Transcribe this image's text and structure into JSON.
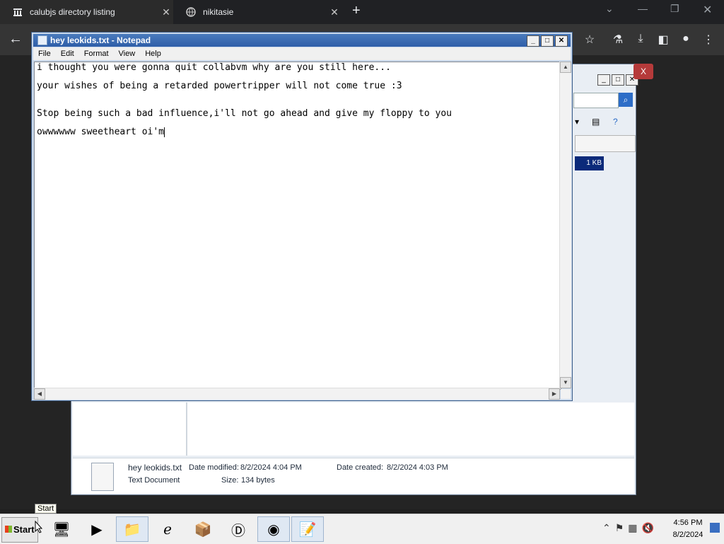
{
  "browser": {
    "tabs": [
      {
        "label": "calubjs directory listing",
        "icon": "bank-icon",
        "active": true
      },
      {
        "label": "nikitasie",
        "icon": "globe-icon",
        "active": false
      }
    ],
    "new_tab_icon": "+"
  },
  "explorer": {
    "selected_file_size": "1 KB",
    "details": {
      "file_name": "hey leokids.txt",
      "file_type": "Text Document",
      "date_modified_label": "Date modified:",
      "date_modified": "8/2/2024 4:04 PM",
      "date_created_label": "Date created:",
      "date_created": "8/2/2024 4:03 PM",
      "size_label": "Size:",
      "size": "134 bytes"
    },
    "overlay_close": "X"
  },
  "notepad": {
    "title": "hey leokids.txt - Notepad",
    "menu": [
      "File",
      "Edit",
      "Format",
      "View",
      "Help"
    ],
    "lines": [
      "i thought you were gonna quit collabvm why are you still here...",
      "your wishes of being a retarded powertripper will not come true :3",
      "Stop being such a bad influence,i'll not go ahead and give my floppy to you",
      "owwwwww sweetheart oi'm"
    ]
  },
  "taskbar": {
    "start_label": "Start",
    "tooltip": "Start",
    "clock_time": "4:56 PM",
    "clock_date": "8/2/2024"
  }
}
